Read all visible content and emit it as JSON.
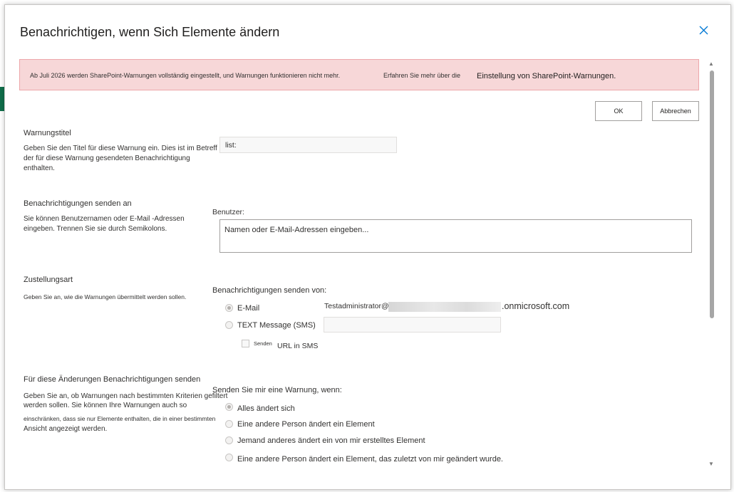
{
  "dialog": {
    "title": "Benachrichtigen, wenn Sich Elemente ändern",
    "close_icon": "close-icon"
  },
  "banner": {
    "message": "Ab Juli 2026 werden SharePoint-Warnungen vollständig eingestellt, und Warnungen funktionieren nicht mehr.",
    "more_text": "Erfahren Sie mehr über die",
    "link_text": "Einstellung von SharePoint-Warnungen."
  },
  "buttons": {
    "ok": "OK",
    "cancel": "Abbrechen"
  },
  "alert_title": {
    "heading": "Warnungstitel",
    "description": "Geben Sie den Titel für diese Warnung ein. Dies ist im Betreff der für diese Warnung gesendeten Benachrichtigung enthalten.",
    "value": "list:"
  },
  "send_to": {
    "heading": "Benachrichtigungen senden an",
    "description": "Sie können Benutzernamen oder E-Mail -Adressen eingeben. Trennen Sie sie durch Semikolons.",
    "users_label": "Benutzer:",
    "placeholder": "Namen oder E-Mail-Adressen eingeben..."
  },
  "delivery": {
    "heading": "Zustellungsart",
    "description": "Geben Sie an, wie die Warnungen übermittelt werden sollen.",
    "send_from_label": "Benachrichtigungen senden von:",
    "email_label": "E-Mail",
    "email_prefix": "Testadministrator@",
    "email_suffix": ".onmicrosoft.com",
    "sms_label": "TEXT Message (SMS)",
    "send_url_small": "Senden",
    "send_url_label": "URL in SMS",
    "selected": "E-Mail"
  },
  "changes": {
    "heading": "Für diese Änderungen Benachrichtigungen senden",
    "description_1": "Geben Sie an, ob Warnungen nach bestimmten Kriterien gefiltert werden sollen. Sie können Ihre Warnungen auch so",
    "description_2": "einschränken, dass sie nur Elemente enthalten, die in einer bestimmten",
    "description_3": "Ansicht angezeigt werden.",
    "prompt": "Senden Sie mir eine Warnung, wenn:",
    "options": [
      "Alles ändert sich",
      "Eine andere Person ändert ein Element",
      "Jemand anderes ändert ein von mir erstelltes Element",
      "Eine andere Person ändert ein Element, das zuletzt von mir geändert wurde."
    ],
    "selected": "Alles ändert sich"
  }
}
